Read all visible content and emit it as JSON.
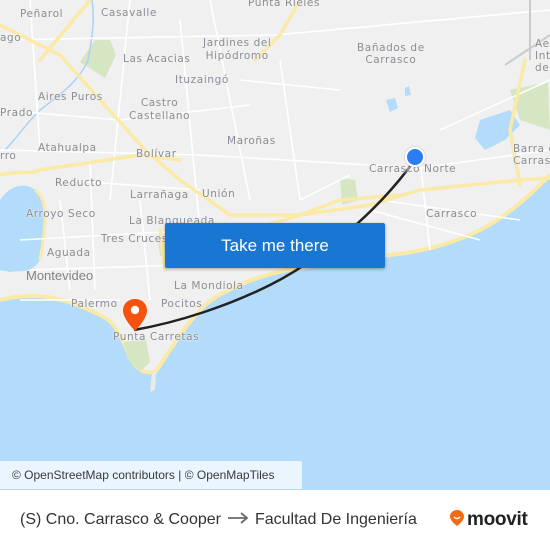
{
  "map": {
    "places": [
      {
        "id": "penarol",
        "label": "Peñarol"
      },
      {
        "id": "casavalle",
        "label": "Casavalle"
      },
      {
        "id": "punta-rieles",
        "label": "Punta Rieles"
      },
      {
        "id": "sayago",
        "label": "ago"
      },
      {
        "id": "jardines",
        "label": "Jardines del\nHipódromo"
      },
      {
        "id": "las-acacias",
        "label": "Las Acacias"
      },
      {
        "id": "banados",
        "label": "Bañados de\nCarrasco"
      },
      {
        "id": "aeropuerto",
        "label": "Ae\nInt\nde"
      },
      {
        "id": "ituzaingo",
        "label": "Ituzaingó"
      },
      {
        "id": "aires-puros",
        "label": "Aires Puros"
      },
      {
        "id": "castro",
        "label": "Castro\nCastellano"
      },
      {
        "id": "prado",
        "label": "Prado"
      },
      {
        "id": "atahualpa",
        "label": "Atahualpa"
      },
      {
        "id": "maronas",
        "label": "Maroñas"
      },
      {
        "id": "barra",
        "label": "Barra d\nCarrasc"
      },
      {
        "id": "cerro",
        "label": "rro"
      },
      {
        "id": "bolivar",
        "label": "Bolívar"
      },
      {
        "id": "carrasco-norte",
        "label": "Carrasco Norte"
      },
      {
        "id": "reducto",
        "label": "Reducto"
      },
      {
        "id": "larranaga",
        "label": "Larrañaga"
      },
      {
        "id": "union",
        "label": "Unión"
      },
      {
        "id": "carrasco",
        "label": "Carrasco"
      },
      {
        "id": "arroyo-seco",
        "label": "Arroyo Seco"
      },
      {
        "id": "la-blanqueada",
        "label": "La Blanqueada"
      },
      {
        "id": "tres-cruces",
        "label": "Tres Cruces"
      },
      {
        "id": "aguada",
        "label": "Aguada"
      },
      {
        "id": "montevideo",
        "label": "Montevideo"
      },
      {
        "id": "la-mondiola",
        "label": "La Mondiola"
      },
      {
        "id": "palermo",
        "label": "Palermo"
      },
      {
        "id": "pocitos",
        "label": "Pocitos"
      },
      {
        "id": "punta-carretas",
        "label": "Punta Carretas"
      }
    ],
    "attribution": "© OpenStreetMap contributors | © OpenMapTiles",
    "origin_marker": "origin-dot-icon",
    "destination_marker": "destination-pin-icon",
    "colors": {
      "water": "#b3dbfa",
      "land": "#f0f0f1",
      "park": "#d6e5c2",
      "major_road": "#fbe9a6",
      "route_line": "#222222",
      "origin": "#2c7cf6",
      "destination": "#f4520d",
      "button": "#1976d2"
    }
  },
  "cta": {
    "label": "Take me there"
  },
  "footer": {
    "origin": "(S) Cno. Carrasco & Cooper",
    "arrow_icon": "arrow-right-icon",
    "destination": "Facultad De Ingeniería",
    "brand": "moovit",
    "brand_color": "#f46a14"
  }
}
